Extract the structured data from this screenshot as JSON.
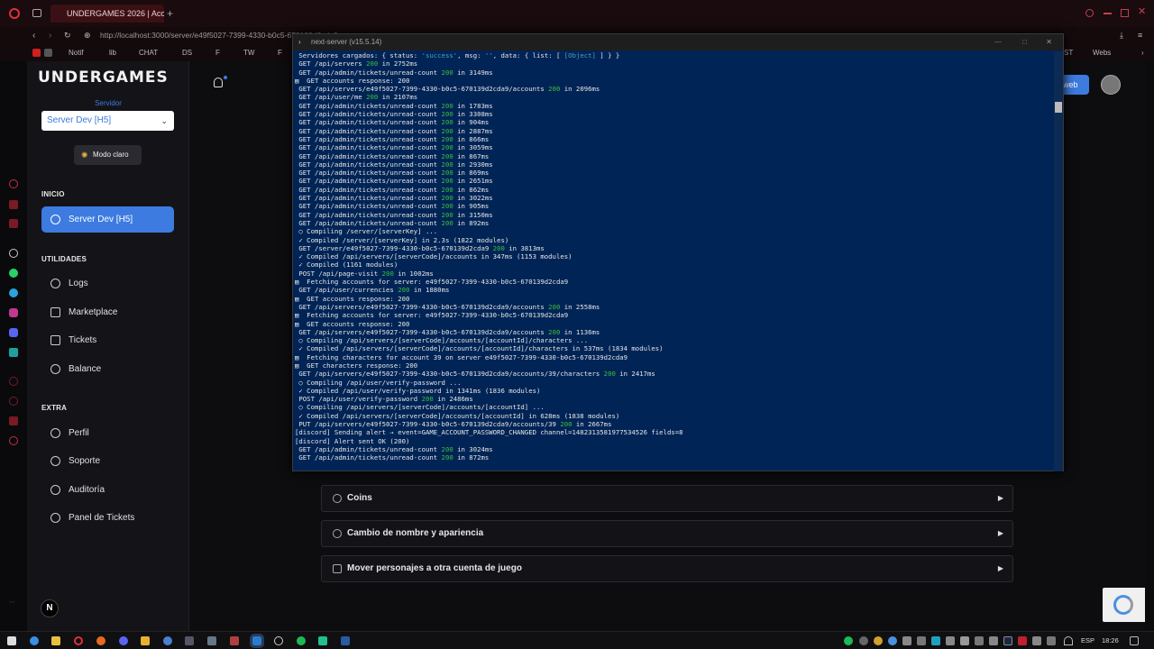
{
  "browser": {
    "tab_title": "UNDERGAMES 2026 | Acc",
    "address": "http://localhost:3000/server/e49f5027-7399-4330-b0c5-670139d2cda9",
    "bookmarks": [
      "Notif",
      "lib",
      "CHAT",
      "DS",
      "F",
      "TW",
      "F"
    ],
    "bookmarks_right": [
      "ST",
      "Webs"
    ]
  },
  "terminal": {
    "title": "next-server (v15.5.14)",
    "lines": [
      [
        [
          "t",
          " Servidores cargados: { status: "
        ],
        [
          "c",
          "'success'"
        ],
        [
          "t",
          ", msg: "
        ],
        [
          "c",
          "''"
        ],
        [
          "t",
          ", data: { list: [ "
        ],
        [
          "c",
          "[Object]"
        ],
        [
          "t",
          " ] } }"
        ]
      ],
      [
        [
          "t",
          " GET /api/servers "
        ],
        [
          "g",
          "200"
        ],
        [
          "t",
          " in 2752ms"
        ]
      ],
      [
        [
          "t",
          " GET /api/admin/tickets/unread-count "
        ],
        [
          "g",
          "200"
        ],
        [
          "t",
          " in 3149ms"
        ]
      ],
      [
        [
          "t",
          "▤  GET accounts response: 200"
        ]
      ],
      [
        [
          "t",
          " GET /api/servers/e49f5027-7399-4330-b0c5-670139d2cda9/accounts "
        ],
        [
          "g",
          "200"
        ],
        [
          "t",
          " in 2096ms"
        ]
      ],
      [
        [
          "t",
          " GET /api/user/me "
        ],
        [
          "g",
          "200"
        ],
        [
          "t",
          " in 2107ms"
        ]
      ],
      [
        [
          "t",
          " GET /api/admin/tickets/unread-count "
        ],
        [
          "g",
          "200"
        ],
        [
          "t",
          " in 1783ms"
        ]
      ],
      [
        [
          "t",
          " GET /api/admin/tickets/unread-count "
        ],
        [
          "g",
          "200"
        ],
        [
          "t",
          " in 3308ms"
        ]
      ],
      [
        [
          "t",
          " GET /api/admin/tickets/unread-count "
        ],
        [
          "g",
          "200"
        ],
        [
          "t",
          " in 904ms"
        ]
      ],
      [
        [
          "t",
          " GET /api/admin/tickets/unread-count "
        ],
        [
          "g",
          "200"
        ],
        [
          "t",
          " in 2887ms"
        ]
      ],
      [
        [
          "t",
          " GET /api/admin/tickets/unread-count "
        ],
        [
          "g",
          "200"
        ],
        [
          "t",
          " in 866ms"
        ]
      ],
      [
        [
          "t",
          " GET /api/admin/tickets/unread-count "
        ],
        [
          "g",
          "200"
        ],
        [
          "t",
          " in 3059ms"
        ]
      ],
      [
        [
          "t",
          " GET /api/admin/tickets/unread-count "
        ],
        [
          "g",
          "200"
        ],
        [
          "t",
          " in 867ms"
        ]
      ],
      [
        [
          "t",
          " GET /api/admin/tickets/unread-count "
        ],
        [
          "g",
          "200"
        ],
        [
          "t",
          " in 2930ms"
        ]
      ],
      [
        [
          "t",
          " GET /api/admin/tickets/unread-count "
        ],
        [
          "g",
          "200"
        ],
        [
          "t",
          " in 869ms"
        ]
      ],
      [
        [
          "t",
          " GET /api/admin/tickets/unread-count "
        ],
        [
          "g",
          "200"
        ],
        [
          "t",
          " in 2651ms"
        ]
      ],
      [
        [
          "t",
          " GET /api/admin/tickets/unread-count "
        ],
        [
          "g",
          "200"
        ],
        [
          "t",
          " in 862ms"
        ]
      ],
      [
        [
          "t",
          " GET /api/admin/tickets/unread-count "
        ],
        [
          "g",
          "200"
        ],
        [
          "t",
          " in 3022ms"
        ]
      ],
      [
        [
          "t",
          " GET /api/admin/tickets/unread-count "
        ],
        [
          "g",
          "200"
        ],
        [
          "t",
          " in 905ms"
        ]
      ],
      [
        [
          "t",
          " GET /api/admin/tickets/unread-count "
        ],
        [
          "g",
          "200"
        ],
        [
          "t",
          " in 3150ms"
        ]
      ],
      [
        [
          "t",
          " GET /api/admin/tickets/unread-count "
        ],
        [
          "g",
          "200"
        ],
        [
          "t",
          " in 892ms"
        ]
      ],
      [
        [
          "t",
          " ○ Compiling /server/[serverKey] ..."
        ]
      ],
      [
        [
          "t",
          " ✓ Compiled /server/[serverKey] in 2.3s (1822 modules)"
        ]
      ],
      [
        [
          "t",
          " GET /server/e49f5027-7399-4330-b0c5-670139d2cda9 "
        ],
        [
          "g",
          "200"
        ],
        [
          "t",
          " in 3813ms"
        ]
      ],
      [
        [
          "t",
          " ✓ Compiled /api/servers/[serverCode]/accounts in 347ms (1153 modules)"
        ]
      ],
      [
        [
          "t",
          " ✓ Compiled (1161 modules)"
        ]
      ],
      [
        [
          "t",
          " POST /api/page-visit "
        ],
        [
          "g",
          "200"
        ],
        [
          "t",
          " in 1002ms"
        ]
      ],
      [
        [
          "t",
          "▤  Fetching accounts for server: e49f5027-7399-4330-b0c5-670139d2cda9"
        ]
      ],
      [
        [
          "t",
          " GET /api/user/currencies "
        ],
        [
          "g",
          "200"
        ],
        [
          "t",
          " in 1880ms"
        ]
      ],
      [
        [
          "t",
          "▤  GET accounts response: 200"
        ]
      ],
      [
        [
          "t",
          " GET /api/servers/e49f5027-7399-4330-b0c5-670139d2cda9/accounts "
        ],
        [
          "g",
          "200"
        ],
        [
          "t",
          " in 2558ms"
        ]
      ],
      [
        [
          "t",
          "▤  Fetching accounts for server: e49f5027-7399-4330-b0c5-670139d2cda9"
        ]
      ],
      [
        [
          "t",
          "▤  GET accounts response: 200"
        ]
      ],
      [
        [
          "t",
          " GET /api/servers/e49f5027-7399-4330-b0c5-670139d2cda9/accounts "
        ],
        [
          "g",
          "200"
        ],
        [
          "t",
          " in 1136ms"
        ]
      ],
      [
        [
          "t",
          " ○ Compiling /api/servers/[serverCode]/accounts/[accountId]/characters ..."
        ]
      ],
      [
        [
          "t",
          " ✓ Compiled /api/servers/[serverCode]/accounts/[accountId]/characters in 537ms (1834 modules)"
        ]
      ],
      [
        [
          "t",
          "▤  Fetching characters for account 39 on server e49f5027-7399-4330-b0c5-670139d2cda9"
        ]
      ],
      [
        [
          "t",
          "▤  GET characters response: 200"
        ]
      ],
      [
        [
          "t",
          " GET /api/servers/e49f5027-7399-4330-b0c5-670139d2cda9/accounts/39/characters "
        ],
        [
          "g",
          "200"
        ],
        [
          "t",
          " in 2417ms"
        ]
      ],
      [
        [
          "t",
          " ○ Compiling /api/user/verify-password ..."
        ]
      ],
      [
        [
          "t",
          " ✓ Compiled /api/user/verify-password in 1341ms (1836 modules)"
        ]
      ],
      [
        [
          "t",
          " POST /api/user/verify-password "
        ],
        [
          "g",
          "200"
        ],
        [
          "t",
          " in 2486ms"
        ]
      ],
      [
        [
          "t",
          " ○ Compiling /api/servers/[serverCode]/accounts/[accountId] ..."
        ]
      ],
      [
        [
          "t",
          " ✓ Compiled /api/servers/[serverCode]/accounts/[accountId] in 628ms (1838 modules)"
        ]
      ],
      [
        [
          "t",
          " PUT /api/servers/e49f5027-7399-4330-b0c5-670139d2cda9/accounts/39 "
        ],
        [
          "g",
          "200"
        ],
        [
          "t",
          " in 2667ms"
        ]
      ],
      [
        [
          "t",
          "[discord] Sending alert → event=GAME_ACCOUNT_PASSWORD_CHANGED channel=1482313581977534526 fields=8"
        ]
      ],
      [
        [
          "t",
          "[discord] Alert sent OK (200)"
        ]
      ],
      [
        [
          "t",
          " GET /api/admin/tickets/unread-count "
        ],
        [
          "g",
          "200"
        ],
        [
          "t",
          " in 3024ms"
        ]
      ],
      [
        [
          "t",
          " GET /api/admin/tickets/unread-count "
        ],
        [
          "g",
          "200"
        ],
        [
          "t",
          " in 872ms"
        ]
      ]
    ]
  },
  "sidebar": {
    "logo": "UNDERGAMES",
    "server_label": "Servidor",
    "server_select": "Server Dev [H5]",
    "mode_button": "Modo claro",
    "sections": {
      "inicio": "INICIO",
      "utilidades": "UTILIDADES",
      "extra": "EXTRA"
    },
    "inicio_items": [
      "Server Dev [H5]"
    ],
    "utilidades_items": [
      "Logs",
      "Marketplace",
      "Tickets",
      "Balance"
    ],
    "extra_items": [
      "Perfil",
      "Soporte",
      "Auditoría",
      "Panel de Tickets"
    ],
    "avatar_letter": "N"
  },
  "header": {
    "web_button": "web"
  },
  "accordions": [
    "Coins",
    "Cambio de nombre y apariencia",
    "Mover personajes a otra cuenta de juego"
  ],
  "taskbar": {
    "language": "ESP",
    "time": "18:26"
  },
  "colors": {
    "accent": "#3d7be0",
    "terminal_bg": "#012456",
    "status_ok": "#3bbf3b",
    "browser_tab": "#3a1014"
  }
}
